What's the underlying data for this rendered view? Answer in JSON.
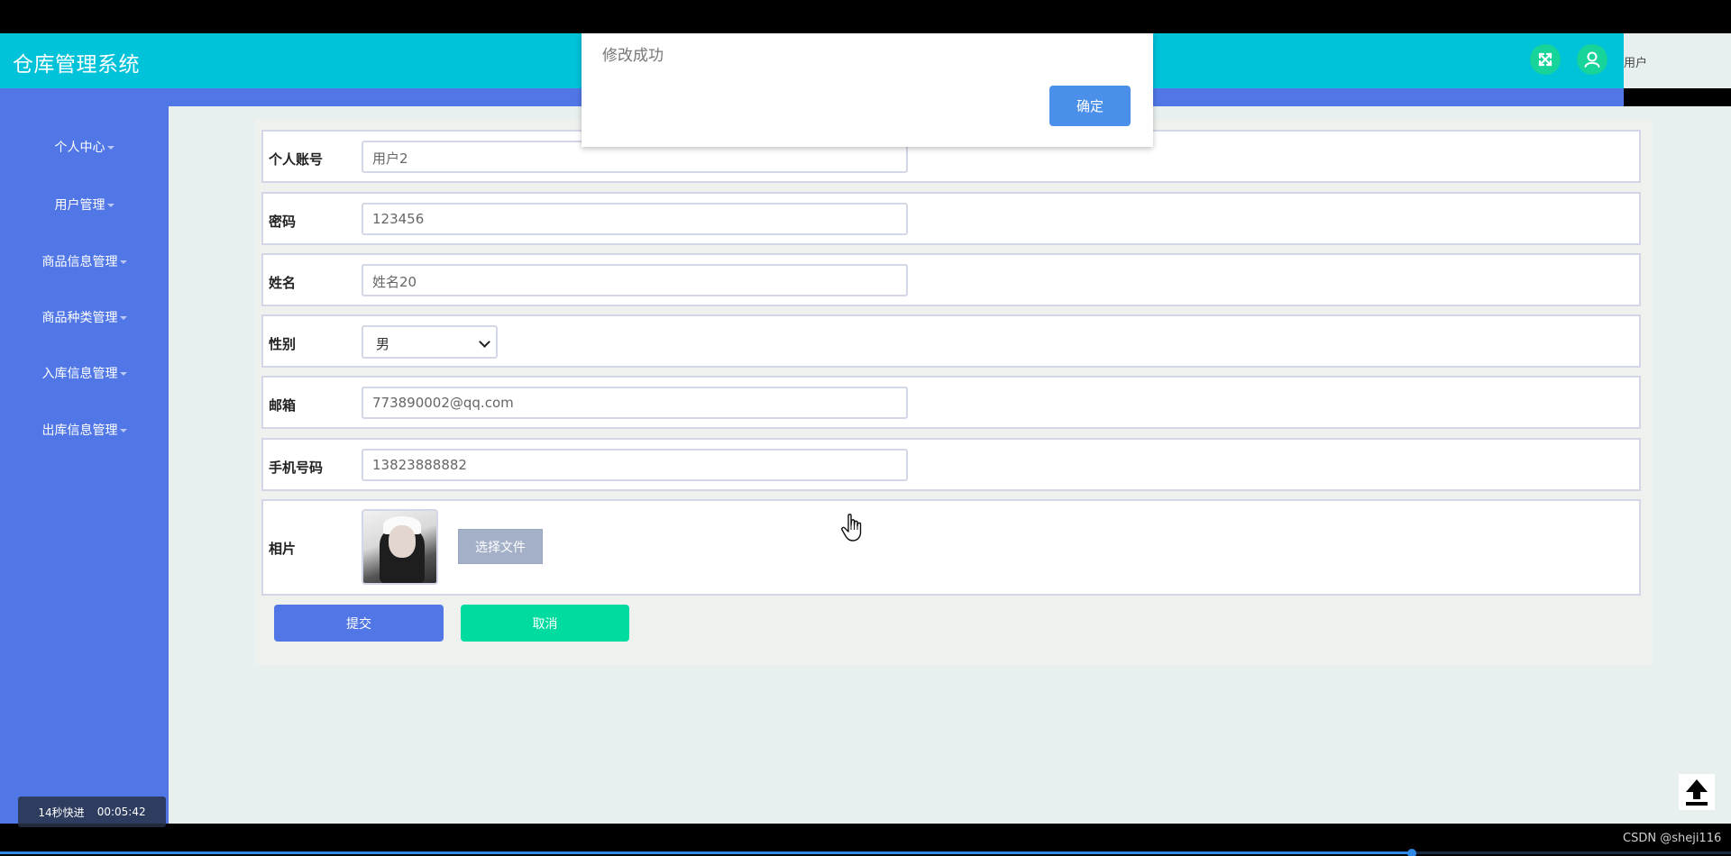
{
  "app": {
    "title": "仓库管理系统",
    "user_label": "用户"
  },
  "sidebar": {
    "items": [
      {
        "label": "个人中心"
      },
      {
        "label": "用户管理"
      },
      {
        "label": "商品信息管理"
      },
      {
        "label": "商品种类管理"
      },
      {
        "label": "入库信息管理"
      },
      {
        "label": "出库信息管理"
      }
    ]
  },
  "form": {
    "account": {
      "label": "个人账号",
      "value": "用户2"
    },
    "password": {
      "label": "密码",
      "value": "123456"
    },
    "name": {
      "label": "姓名",
      "value": "姓名20"
    },
    "gender": {
      "label": "性别",
      "value": "男"
    },
    "email": {
      "label": "邮箱",
      "value": "773890002@qq.com"
    },
    "phone": {
      "label": "手机号码",
      "value": "13823888882"
    },
    "photo": {
      "label": "相片",
      "choose_file": "选择文件"
    },
    "submit_label": "提交",
    "cancel_label": "取消"
  },
  "dialog": {
    "message": "修改成功",
    "ok_label": "确定"
  },
  "video": {
    "skip_label": "14秒快进",
    "timestamp": "00:05:42",
    "progress": 0.815
  },
  "watermark": "CSDN @sheji116",
  "colors": {
    "header": "#00c2d9",
    "sidebar": "#5177e6",
    "accent_green": "#00dca0"
  }
}
